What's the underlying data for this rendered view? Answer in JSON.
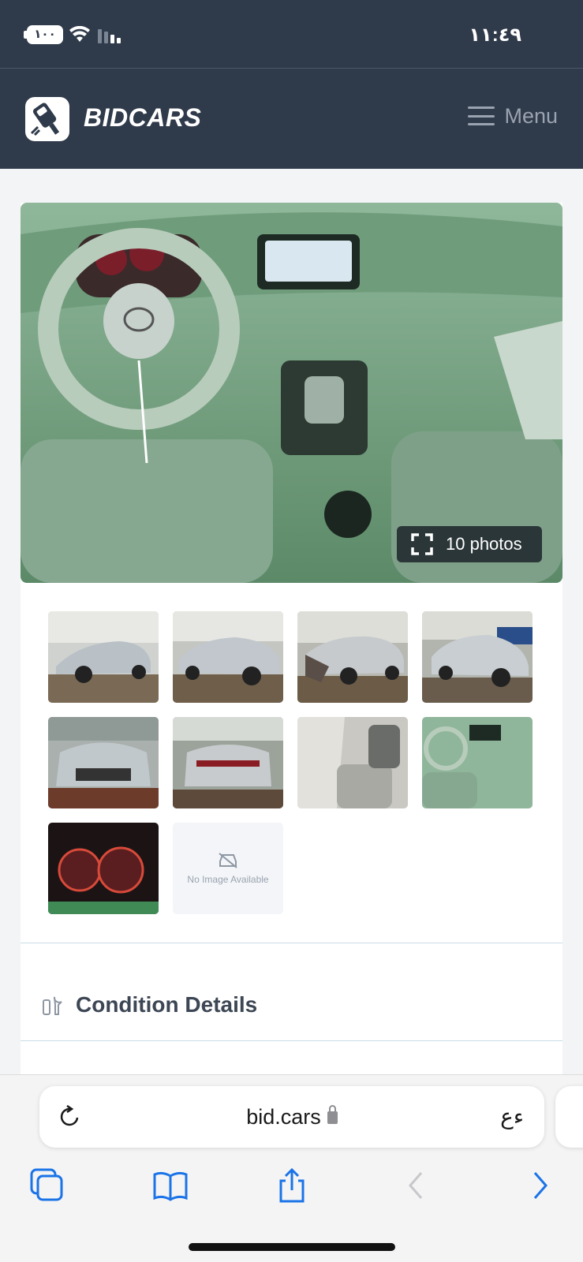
{
  "status_bar": {
    "battery": "١٠٠",
    "time": "١١:٤٩"
  },
  "header": {
    "brand": "BIDCARS",
    "menu_label": "Menu"
  },
  "gallery": {
    "photo_count_label": "10 photos",
    "thumbnails": [
      "exterior-front-left",
      "exterior-rear-left",
      "exterior-rear-damage",
      "exterior-front-right",
      "exterior-front",
      "exterior-rear",
      "interior-passenger",
      "interior-dashboard",
      "instrument-cluster"
    ],
    "no_image_label": "No Image Available"
  },
  "sections": {
    "condition_title": "Condition Details"
  },
  "browser": {
    "url": "bid.cars",
    "text_size_label": "ﺀﻉ",
    "accent_color": "#1a73e8"
  }
}
